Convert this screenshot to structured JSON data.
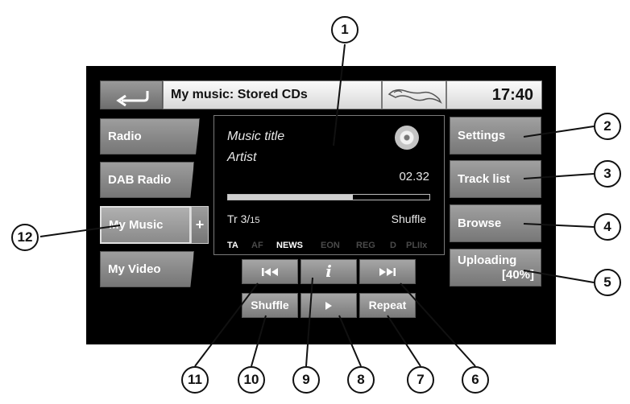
{
  "header": {
    "title": "My music: Stored CDs",
    "clock": "17:40"
  },
  "sources": [
    {
      "label": "Radio"
    },
    {
      "label": "DAB Radio"
    },
    {
      "label": "My Music"
    },
    {
      "label": "My Video"
    }
  ],
  "plus_label": "+",
  "right_buttons": [
    {
      "label": "Settings"
    },
    {
      "label": "Track list"
    },
    {
      "label": "Browse"
    },
    {
      "label": "Uploading",
      "label2": "[40%]"
    }
  ],
  "media": {
    "title": "Music title",
    "artist": "Artist",
    "time": "02.32",
    "track": "Tr 3/",
    "track_total": "15",
    "mode": "Shuffle",
    "progress_fraction": 0.62,
    "flags": [
      {
        "label": "TA",
        "active": true
      },
      {
        "label": "AF",
        "active": false
      },
      {
        "label": "NEWS",
        "active": true
      },
      {
        "label": "EON",
        "active": false
      },
      {
        "label": "REG",
        "active": false
      },
      {
        "label": "D",
        "active": false
      },
      {
        "label": "PLIIx",
        "active": false
      }
    ]
  },
  "transport": {
    "prev_icon": "skip-back-icon",
    "info_icon": "info-icon",
    "next_icon": "skip-forward-icon",
    "shuffle_label": "Shuffle",
    "play_icon": "play-icon",
    "repeat_label": "Repeat"
  },
  "callouts": [
    "1",
    "2",
    "3",
    "4",
    "5",
    "6",
    "7",
    "8",
    "9",
    "10",
    "11",
    "12"
  ],
  "colors": {
    "screen": "#000000",
    "button": "#8a8a8a",
    "flag_active": "#ffffff",
    "flag_inactive": "#4a4a4a"
  }
}
